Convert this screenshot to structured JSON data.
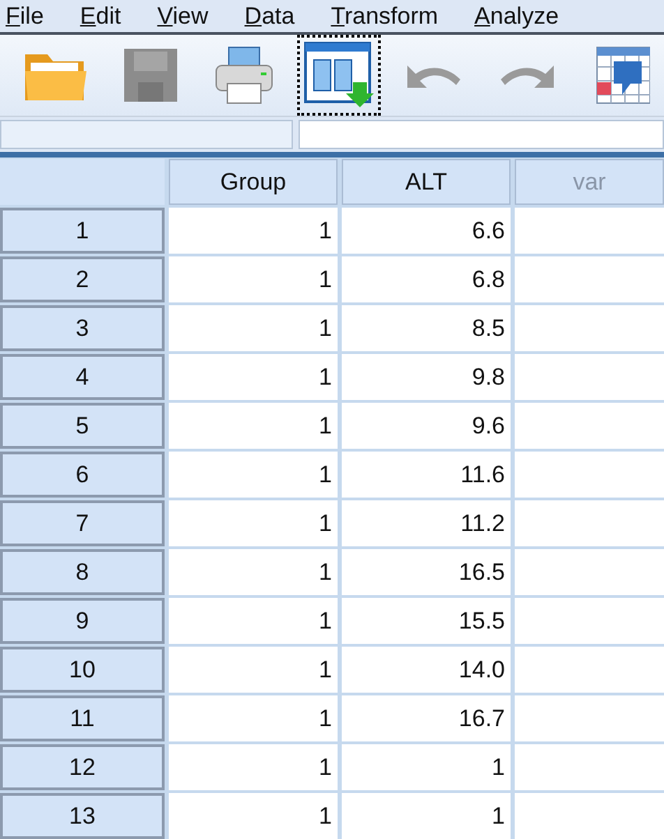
{
  "menu": [
    "File",
    "Edit",
    "View",
    "Data",
    "Transform",
    "Analyze"
  ],
  "toolbar": [
    {
      "kind": "open",
      "disabled": false,
      "focused": false
    },
    {
      "kind": "save",
      "disabled": true,
      "focused": false
    },
    {
      "kind": "print",
      "disabled": false,
      "focused": false
    },
    {
      "kind": "dialog",
      "disabled": false,
      "focused": true
    },
    {
      "kind": "undo",
      "disabled": true,
      "focused": false
    },
    {
      "kind": "redo",
      "disabled": true,
      "focused": false
    },
    {
      "kind": "goto",
      "disabled": false,
      "focused": false
    }
  ],
  "columns": [
    {
      "name": "Group",
      "defined": true
    },
    {
      "name": "ALT",
      "defined": true
    },
    {
      "name": "var",
      "defined": false
    }
  ],
  "rows": [
    {
      "n": "1",
      "cells": [
        "1",
        "6.6"
      ]
    },
    {
      "n": "2",
      "cells": [
        "1",
        "6.8"
      ]
    },
    {
      "n": "3",
      "cells": [
        "1",
        "8.5"
      ]
    },
    {
      "n": "4",
      "cells": [
        "1",
        "9.8"
      ]
    },
    {
      "n": "5",
      "cells": [
        "1",
        "9.6"
      ]
    },
    {
      "n": "6",
      "cells": [
        "1",
        "11.6"
      ]
    },
    {
      "n": "7",
      "cells": [
        "1",
        "11.2"
      ]
    },
    {
      "n": "8",
      "cells": [
        "1",
        "16.5"
      ]
    },
    {
      "n": "9",
      "cells": [
        "1",
        "15.5"
      ]
    },
    {
      "n": "10",
      "cells": [
        "1",
        "14.0"
      ]
    },
    {
      "n": "11",
      "cells": [
        "1",
        "16.7"
      ]
    },
    {
      "n": "12",
      "cells": [
        "1",
        "1"
      ]
    },
    {
      "n": "13",
      "cells": [
        "1",
        "1"
      ]
    }
  ]
}
